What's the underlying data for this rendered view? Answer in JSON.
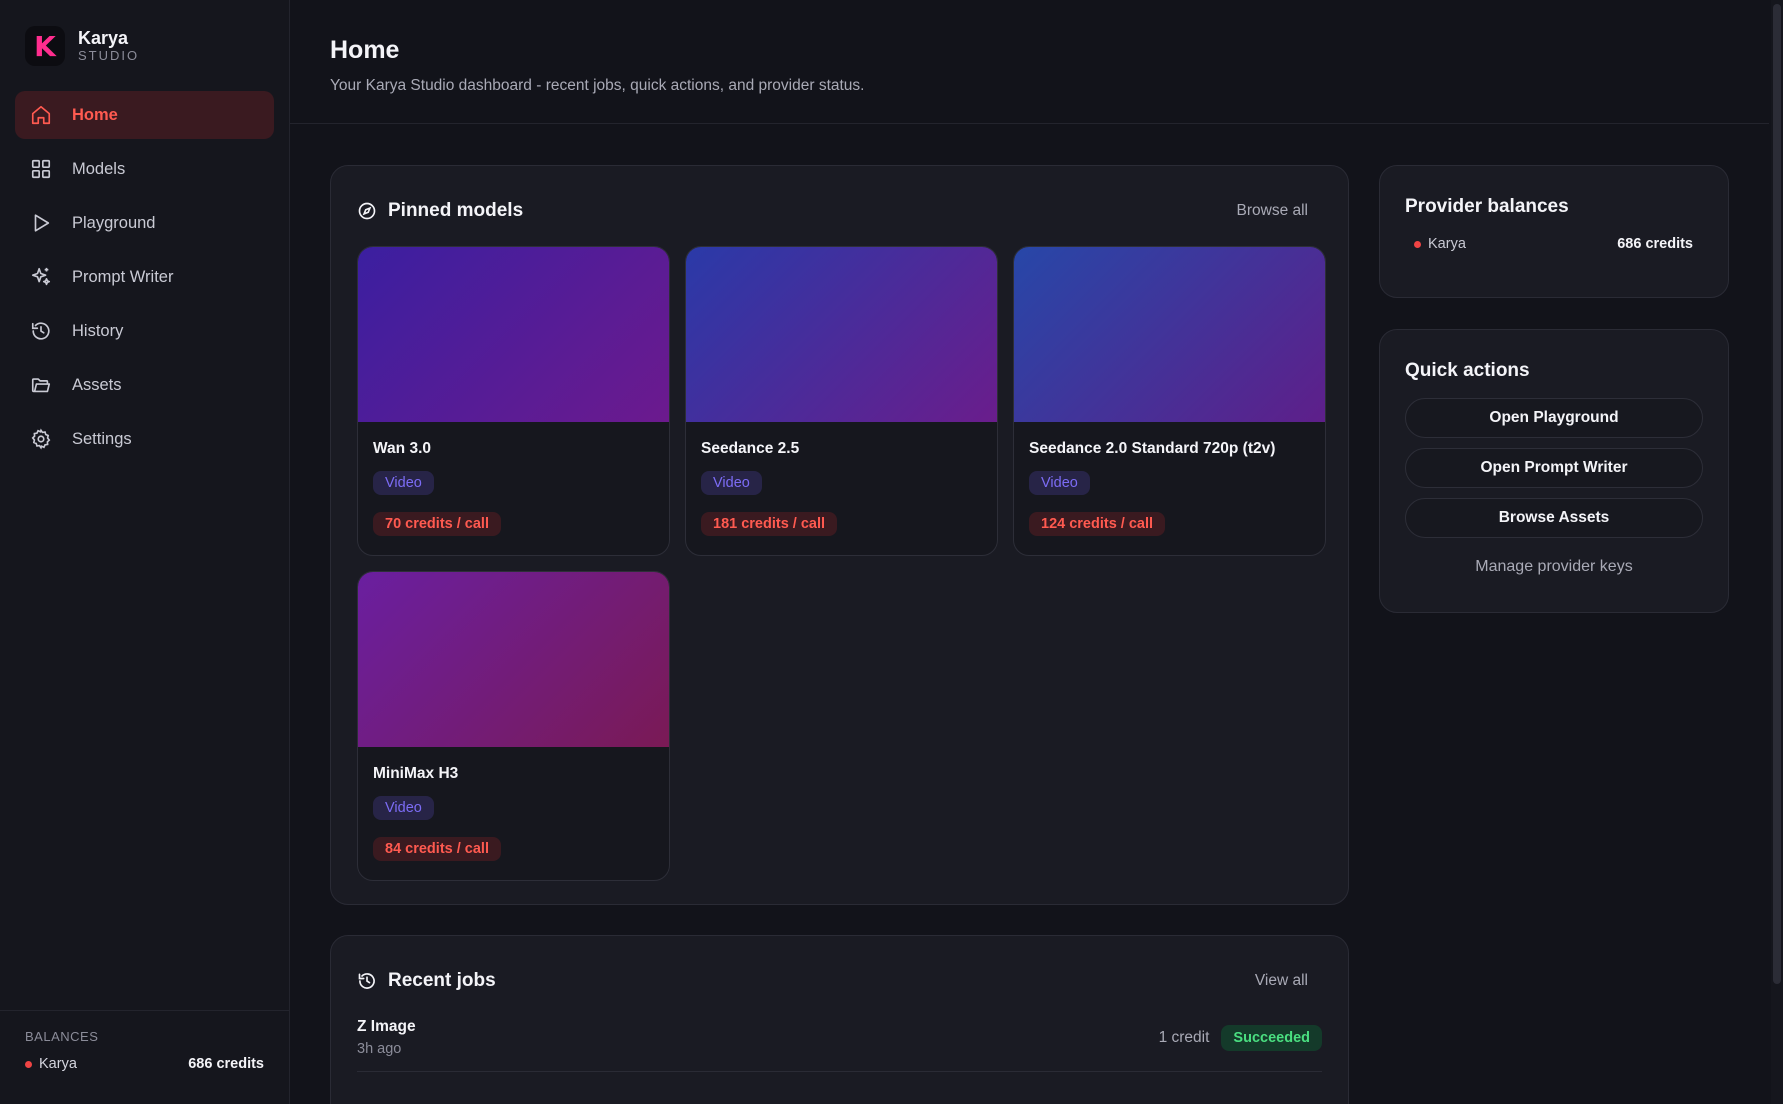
{
  "brand": {
    "name": "Karya",
    "sub": "STUDIO",
    "logo_letter": "K"
  },
  "nav": [
    {
      "label": "Home",
      "icon": "home-icon",
      "active": true
    },
    {
      "label": "Models",
      "icon": "grid-icon",
      "active": false
    },
    {
      "label": "Playground",
      "icon": "play-icon",
      "active": false
    },
    {
      "label": "Prompt Writer",
      "icon": "sparkles-icon",
      "active": false
    },
    {
      "label": "History",
      "icon": "history-icon",
      "active": false
    },
    {
      "label": "Assets",
      "icon": "folder-icon",
      "active": false
    },
    {
      "label": "Settings",
      "icon": "gear-icon",
      "active": false
    }
  ],
  "sidebar_balances": {
    "label": "BALANCES",
    "provider": "Karya",
    "amount": "686 credits"
  },
  "header": {
    "title": "Home",
    "subtitle": "Your Karya Studio dashboard - recent jobs, quick actions, and provider status."
  },
  "pinned": {
    "title": "Pinned models",
    "browse_label": "Browse all",
    "models": [
      {
        "name": "Wan 3.0",
        "type": "Video",
        "credits": "70 credits / call",
        "gradient": [
          "#3b1fa0",
          "#6c1a8e"
        ]
      },
      {
        "name": "Seedance 2.5",
        "type": "Video",
        "credits": "181 credits / call",
        "gradient": [
          "#2a3aa8",
          "#6a1d8c"
        ]
      },
      {
        "name": "Seedance 2.0 Standard 720p (t2v)",
        "type": "Video",
        "credits": "124 credits / call",
        "gradient": [
          "#2747a8",
          "#5e1f8a"
        ]
      },
      {
        "name": "MiniMax H3",
        "type": "Video",
        "credits": "84 credits / call",
        "gradient": [
          "#6a1fa0",
          "#7a1a55"
        ]
      }
    ]
  },
  "provider_balances": {
    "title": "Provider balances",
    "provider": "Karya",
    "amount": "686 credits"
  },
  "quick_actions": {
    "title": "Quick actions",
    "buttons": [
      "Open Playground",
      "Open Prompt Writer",
      "Browse Assets"
    ],
    "link": "Manage provider keys"
  },
  "recent_jobs": {
    "title": "Recent jobs",
    "view_all_label": "View all",
    "jobs": [
      {
        "name": "Z Image",
        "time": "3h ago",
        "cost": "1 credit",
        "status": "Succeeded"
      }
    ]
  }
}
